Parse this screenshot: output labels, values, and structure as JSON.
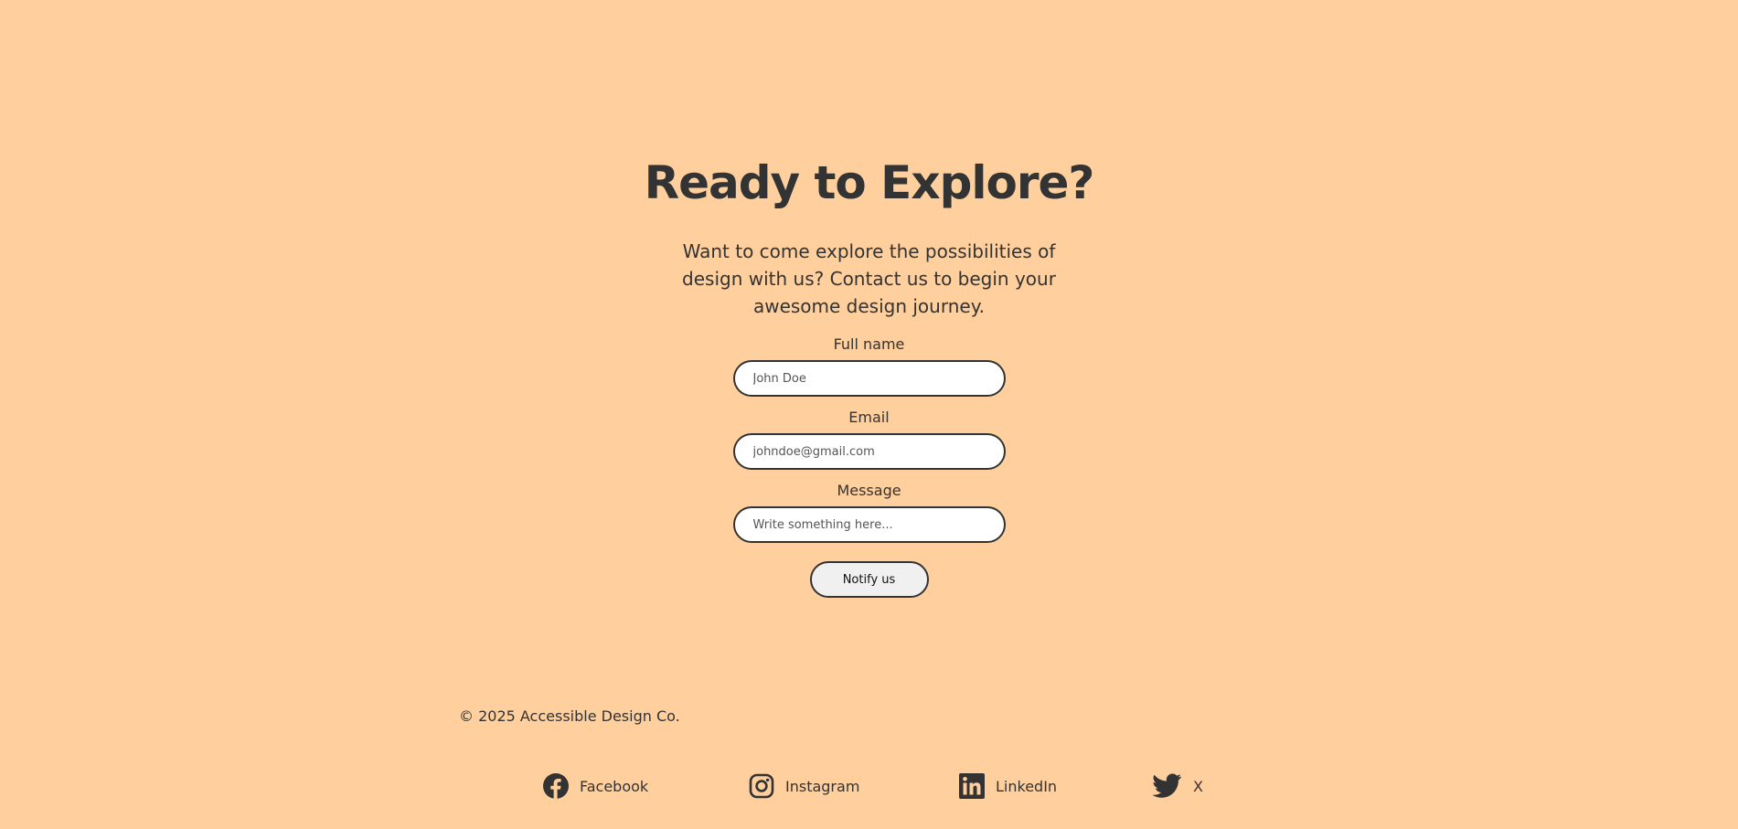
{
  "hero": {
    "title": "Ready to Explore?",
    "subtitle": "Want to come explore the possibilities of design with us? Contact us to begin your awesome design journey."
  },
  "form": {
    "full_name_label": "Full name",
    "full_name_placeholder": "John Doe",
    "email_label": "Email",
    "email_placeholder": "johndoe@gmail.com",
    "message_label": "Message",
    "message_placeholder": "Write something here...",
    "submit_label": "Notify us"
  },
  "footer": {
    "copyright": "© 2025 Accessible Design Co.",
    "social": [
      {
        "label": "Facebook",
        "icon": "facebook-icon"
      },
      {
        "label": "Instagram",
        "icon": "instagram-icon"
      },
      {
        "label": "LinkedIn",
        "icon": "linkedin-icon"
      },
      {
        "label": "X",
        "icon": "twitter-bird-icon"
      }
    ]
  },
  "colors": {
    "background": "#ffcf9d",
    "text": "#333333",
    "input_background": "#ffffff",
    "button_background": "#f0f0f0"
  }
}
